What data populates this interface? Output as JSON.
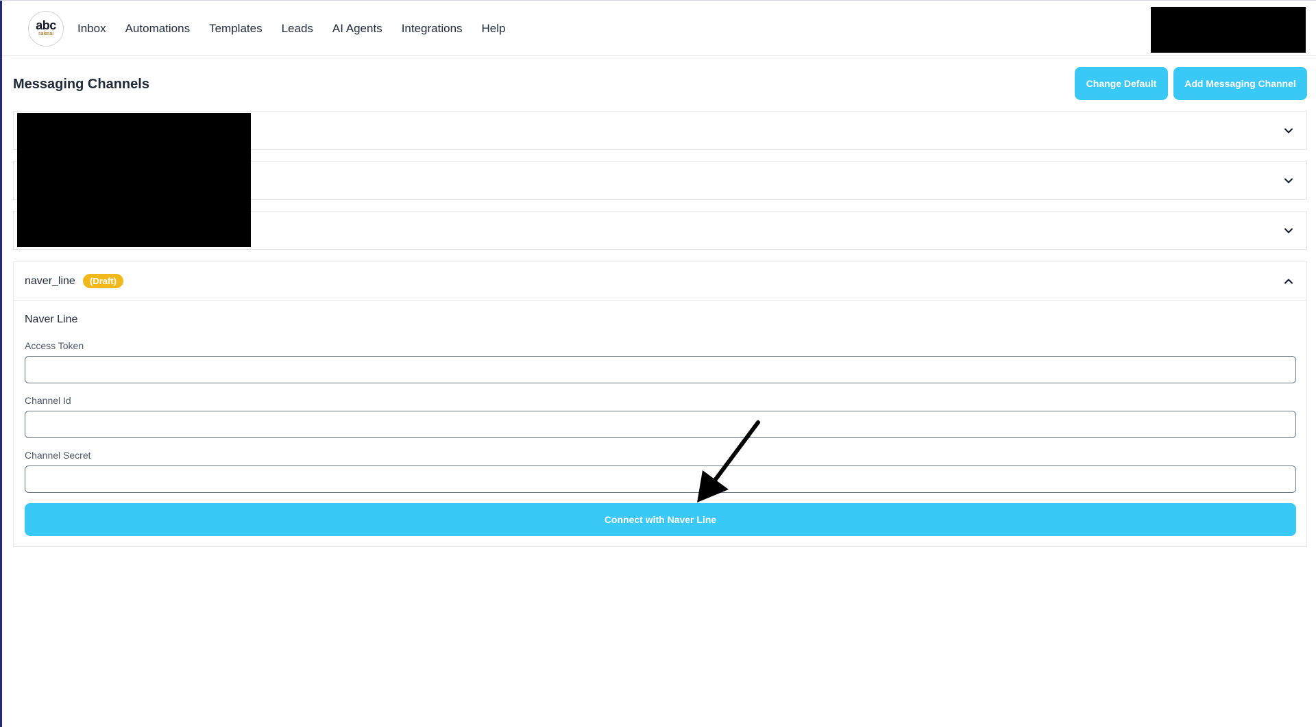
{
  "header": {
    "logo": {
      "main": "abc",
      "sub": "salesai"
    },
    "nav": [
      "Inbox",
      "Automations",
      "Templates",
      "Leads",
      "AI Agents",
      "Integrations",
      "Help"
    ]
  },
  "page": {
    "title": "Messaging Channels",
    "change_default_label": "Change Default",
    "add_channel_label": "Add Messaging Channel"
  },
  "expanded_channel": {
    "name": "naver_line",
    "status": "(Draft)",
    "section_title": "Naver Line",
    "fields": [
      {
        "label": "Access Token",
        "value": ""
      },
      {
        "label": "Channel Id",
        "value": ""
      },
      {
        "label": "Channel Secret",
        "value": ""
      }
    ],
    "connect_label": "Connect with Naver Line"
  },
  "colors": {
    "accent": "#3ac8f6",
    "badge": "#f1b81c",
    "left_bar": "#1e2a78"
  },
  "icons": [
    "chevron-down-icon",
    "chevron-up-icon",
    "annotation-arrow"
  ]
}
